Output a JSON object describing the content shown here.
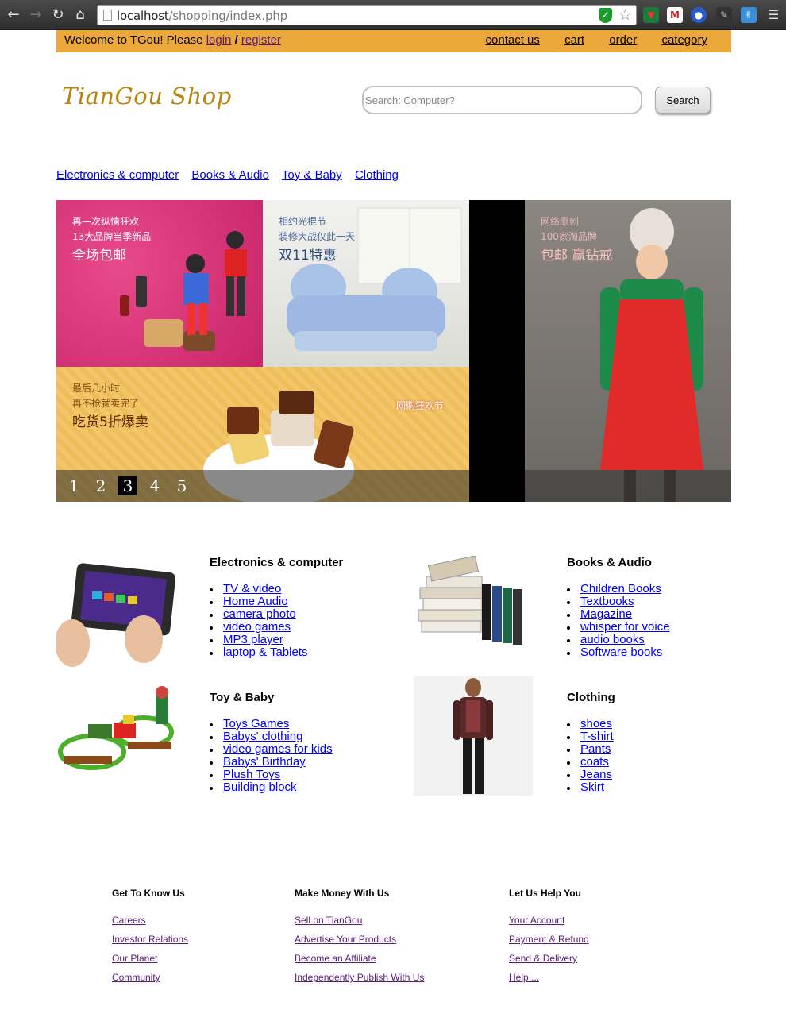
{
  "browser": {
    "url_host": "localhost",
    "url_path": "/shopping/index.php"
  },
  "topbar": {
    "welcome_text": "Welcome to TGou! Please ",
    "login": "login",
    "separator": " / ",
    "register": "register",
    "nav": [
      "contact us",
      "cart",
      "order",
      "category"
    ]
  },
  "header": {
    "logo": "TianGou Shop",
    "search_placeholder": "Search: Computer?",
    "search_button": "Search"
  },
  "category_nav": [
    "Electronics & computer",
    "Books & Audio",
    "Toy & Baby",
    "Clothing"
  ],
  "banner": {
    "tile1": [
      "再一次纵情狂欢",
      "13大品牌当季新品",
      "全场包邮"
    ],
    "tile2": [
      "相约光棍节",
      "装修大战仅此一天",
      "双11特惠"
    ],
    "tile3": [
      "最后几小时",
      "再不抢就卖完了",
      "吃货5折爆卖"
    ],
    "tile3_stamp": "网购狂欢节",
    "tile5": [
      "网络原创",
      "100家淘品牌",
      "包邮 赢钻戒"
    ],
    "pager": [
      "1",
      "2",
      "3",
      "4",
      "5"
    ],
    "active_page": "3"
  },
  "categories": [
    {
      "title": "Electronics & computer",
      "items": [
        "TV & video",
        "Home Audio",
        "camera photo",
        "video games",
        "MP3 player",
        "laptop & Tablets"
      ]
    },
    {
      "title": "Books & Audio",
      "items": [
        "Children Books",
        "Textbooks",
        "Magazine",
        "whisper for voice",
        "audio books",
        "Software books"
      ]
    },
    {
      "title": "Toy & Baby",
      "items": [
        "Toys Games",
        "Babys' clothing",
        "video games for kids",
        "Babys' Birthday",
        "Plush Toys",
        "Building block"
      ]
    },
    {
      "title": "Clothing",
      "items": [
        "shoes",
        "T-shirt",
        "Pants",
        "coats",
        "Jeans",
        "Skirt"
      ]
    }
  ],
  "footer": [
    {
      "title": "Get To Know Us",
      "links": [
        "Careers",
        "Investor Relations",
        "Our Planet",
        "Community"
      ]
    },
    {
      "title": "Make Money With Us",
      "links": [
        "Sell on TianGou",
        "Advertise Your Products",
        "Become an Affiliate",
        "Independently Publish With Us"
      ]
    },
    {
      "title": "Let Us Help You",
      "links": [
        "Your Account",
        "Payment & Refund",
        "Send & Delivery",
        "Help ..."
      ]
    }
  ]
}
